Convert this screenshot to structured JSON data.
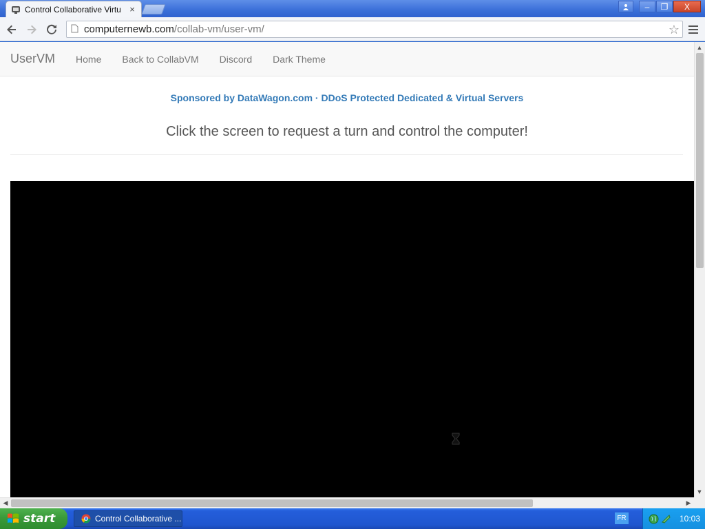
{
  "browser": {
    "tab": {
      "title": "Control Collaborative Virtu",
      "icon": "collabvm-favicon",
      "close_icon": "×"
    },
    "window_controls": {
      "user": "👤",
      "minimize": "–",
      "restore": "❐",
      "close": "X"
    },
    "address_bar": {
      "host": "computernewb.com",
      "path": "/collab-vm/user-vm/"
    }
  },
  "page": {
    "nav": {
      "brand": "UserVM",
      "links": [
        "Home",
        "Back to CollabVM",
        "Discord",
        "Dark Theme"
      ]
    },
    "sponsor_text": "Sponsored by DataWagon.com · DDoS Protected Dedicated & Virtual Servers",
    "headline": "Click the screen to request a turn and control the computer!"
  },
  "taskbar": {
    "start_label": "start",
    "task_item_label": "Control Collaborative ...",
    "language": "FR",
    "clock": "10:03"
  },
  "colors": {
    "sponsor_link": "#337ab7",
    "vm_screen": "#000000",
    "taskbar": "#245edb",
    "start_button": "#3a9a3a"
  }
}
